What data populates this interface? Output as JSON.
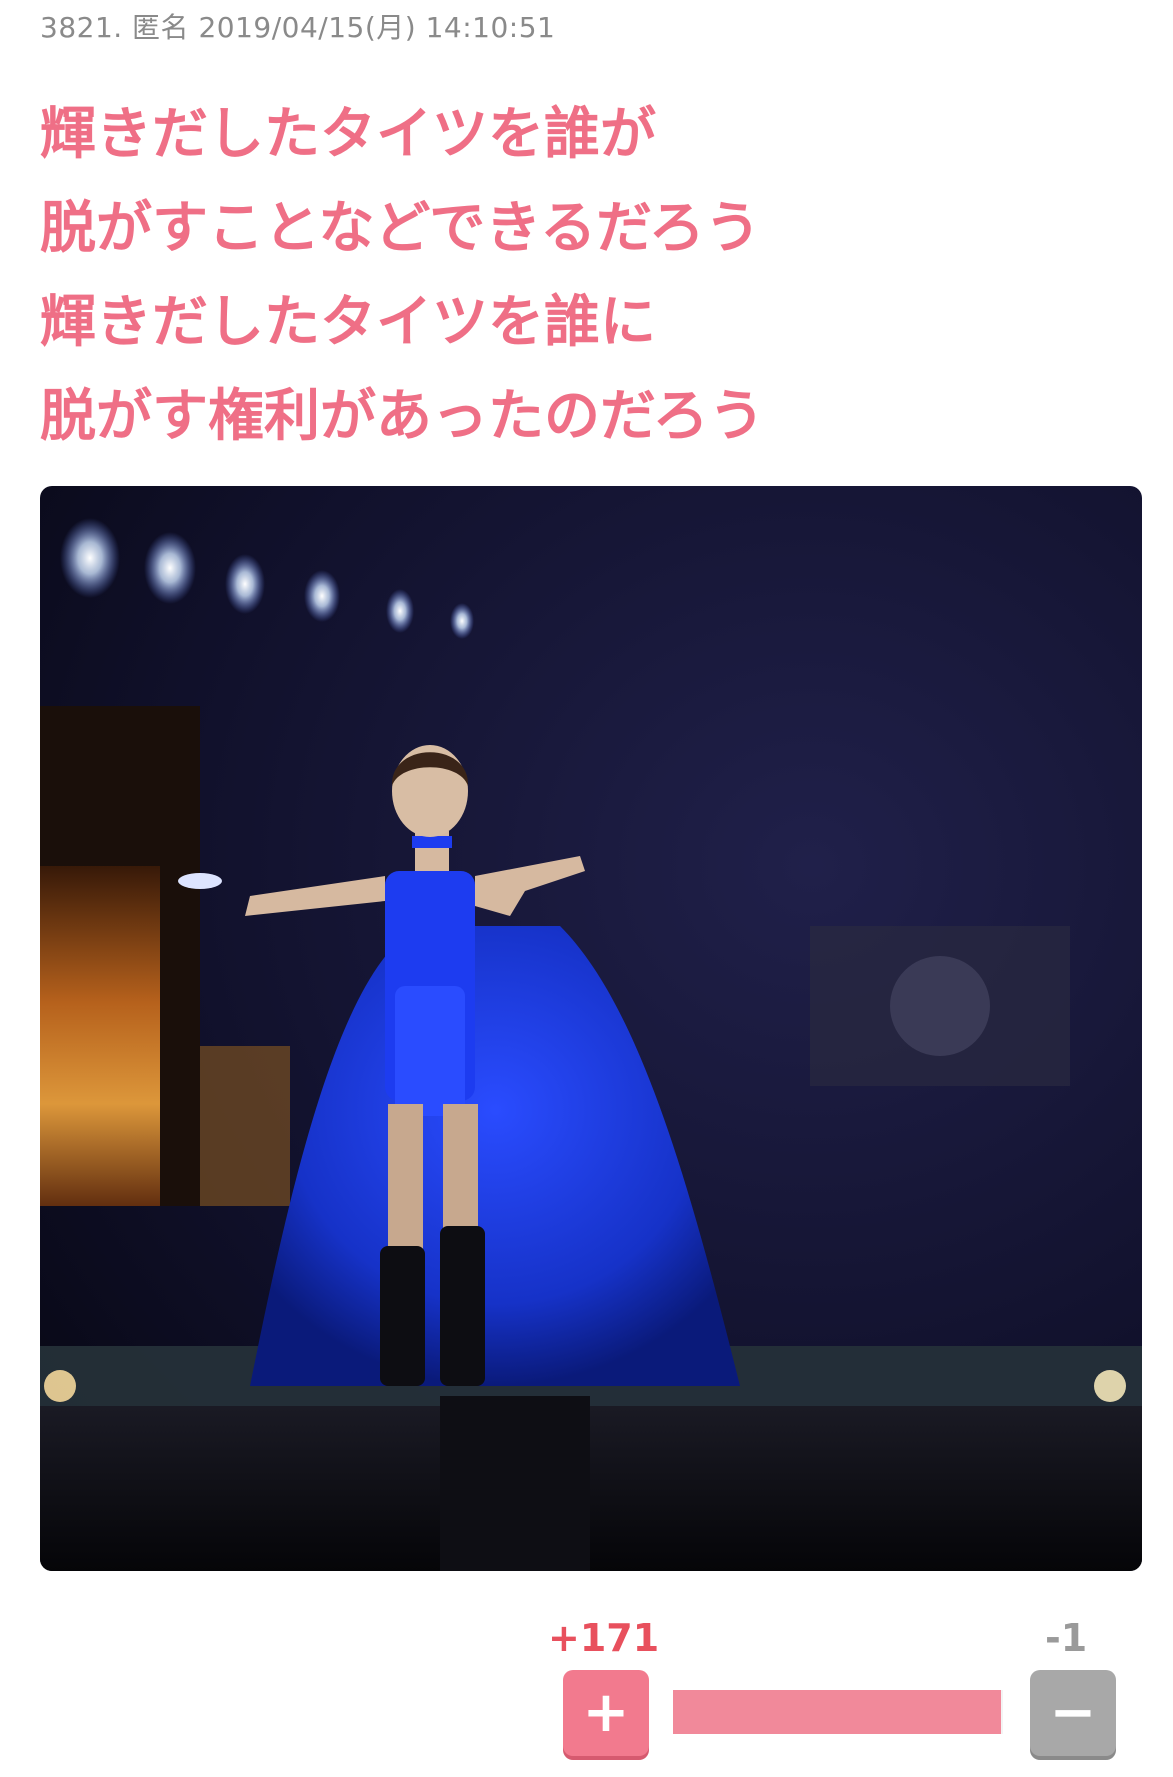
{
  "comment": {
    "header": "3821. 匿名 2019/04/15(月) 14:10:51",
    "lines": [
      "輝きだしたタイツを誰が",
      "脱がすことなどできるだろう",
      "輝きだしたタイツを誰に",
      "脱がす権利があったのだろう"
    ]
  },
  "votes": {
    "plus_label": "+171",
    "minus_label": "-1",
    "plus_value": 171,
    "minus_value": 1,
    "plus_fill_fraction": 0.994
  },
  "icons": {
    "plus": "plus-icon",
    "minus": "minus-icon"
  },
  "colors": {
    "accent_pink": "#ef6f86",
    "plus_red": "#e8505d",
    "minus_gray": "#9a9a9a"
  }
}
